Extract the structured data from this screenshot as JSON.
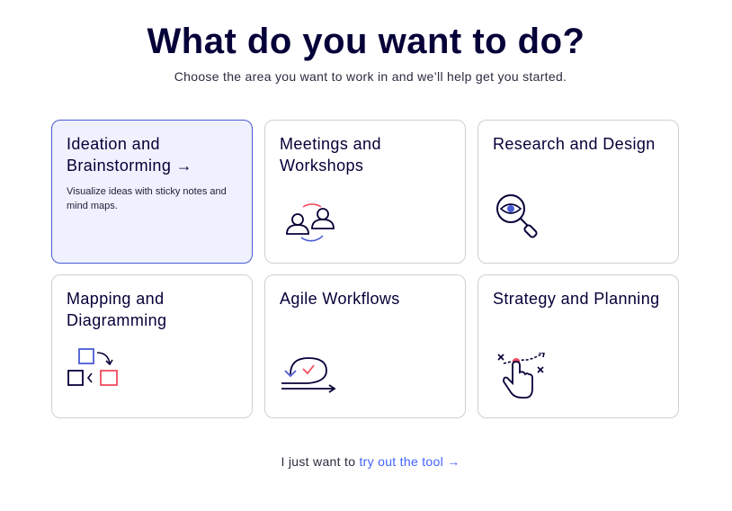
{
  "header": {
    "title": "What do you want to do?",
    "subtitle": "Choose the area you want to work in and we’ll help get you started."
  },
  "cards": [
    {
      "title": "Ideation and Brainstorming",
      "arrow": "→",
      "description": "Visualize ideas with sticky notes and mind maps.",
      "icon": "arrow-right-icon",
      "selected": true
    },
    {
      "title": "Meetings and Workshops",
      "icon": "people-sync-icon"
    },
    {
      "title": "Research and Design",
      "icon": "magnifier-eye-icon"
    },
    {
      "title": "Mapping and Diagramming",
      "icon": "shapes-flow-icon"
    },
    {
      "title": "Agile Workflows",
      "icon": "loop-check-icon"
    },
    {
      "title": "Strategy and Planning",
      "icon": "hand-strategy-icon"
    }
  ],
  "footer": {
    "prefix": "I just want to",
    "link": "try out the tool →"
  },
  "colors": {
    "navy": "#050038",
    "accent_blue": "#4262ff",
    "selected_bg": "#eff1fe",
    "selected_border": "#4a5bd4",
    "coral": "#f24d5f"
  }
}
